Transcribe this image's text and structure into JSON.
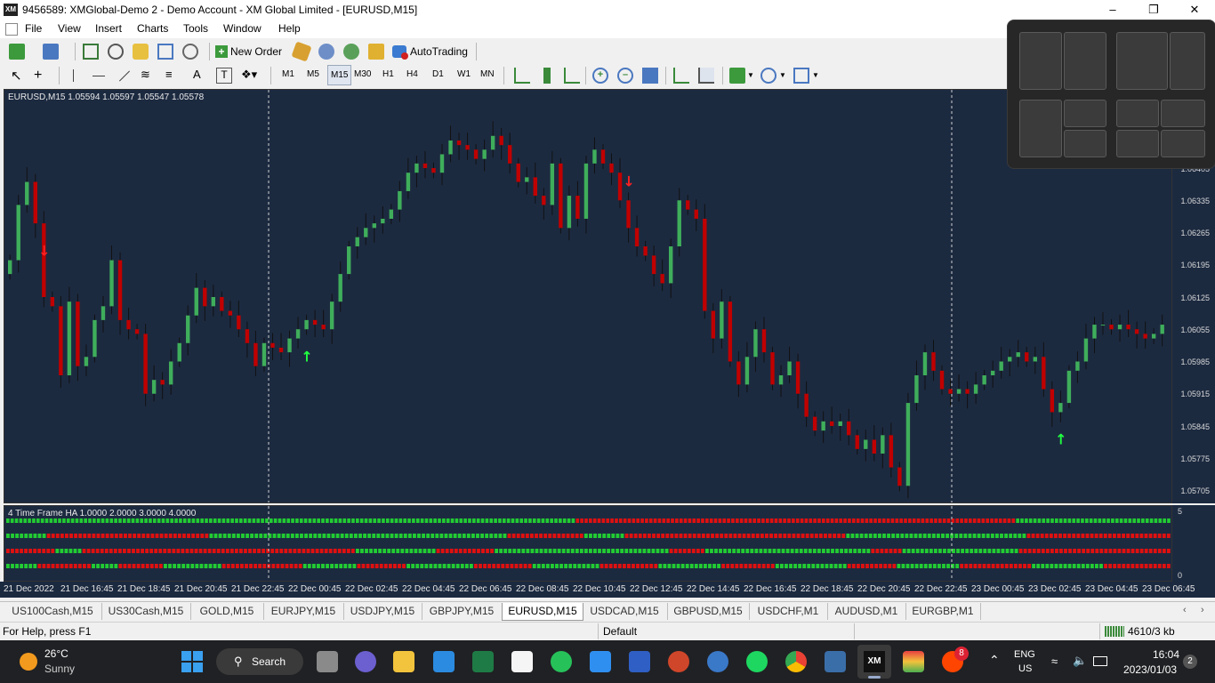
{
  "window": {
    "logo": "XM",
    "title": "9456589: XMGlobal-Demo 2 - Demo Account - XM Global Limited - [EURUSD,M15]",
    "min_icon": "minimize-icon",
    "max_icon": "restore-icon",
    "close_icon": "close-icon"
  },
  "menu": [
    "File",
    "View",
    "Insert",
    "Charts",
    "Tools",
    "Window",
    "Help"
  ],
  "toolbar": {
    "new_order": "New Order",
    "autotrading": "AutoTrading",
    "timeframes": [
      "M1",
      "M5",
      "M15",
      "M30",
      "H1",
      "H4",
      "D1",
      "W1",
      "MN"
    ],
    "active_timeframe": "M15"
  },
  "chart": {
    "header": "EURUSD,M15  1.05594 1.05597 1.05547 1.05578",
    "bg": "#1c2a40",
    "bull_color": "#3fae5b",
    "bear_color": "#c00000"
  },
  "price_axis": [
    "1.06405",
    "1.06335",
    "1.06265",
    "1.06195",
    "1.06125",
    "1.06055",
    "1.05985",
    "1.05915",
    "1.05845",
    "1.05775",
    "1.05705"
  ],
  "indicator": {
    "header": "4 Time Frame HA 1.0000 2.0000 3.0000 4.0000",
    "axis_top": "5",
    "axis_bottom": "0",
    "rows": [
      "GGGGGGGGGGGGGGGGGGGGGGGGGGGGGGGGGGGGGGGGGGGGGGGGGGGGGGGGGGGGGGGGGGGGGGGGGGGGGGGGGGGGGGGGGGGGGGGGGGGGGGGGGGGGGGGGGGGGGGGGGGGGGGGGGGGGRRRRRRRRRRRRRRRRRRRRRRRRRRRRRRRRRRRRRRRRRRRRRRRRRRRRRRRRRRRRRRRRRRRRRRRRRRRRRRRRRRRRRRRRRRRRRRRRRRRRRRGGGGGGGGGGGGGGGGGGGGGGGGGGGGGGGGGGGG",
      "GGGGGGGGGRRRRRRRRRRRRRRRRRRRRRRRRRRRRRRRRRRRRGGGGGGGGGGGGGGGGGGGGGGGGGGGGGGGGGGGGGGGGGGGGGGGGGGGGGGGGGGGGGGGGGGRRRRRRRRRRRRRRRRRGGGGGGGGGRRRRRRRRRRRRRRRRRRRRRRRRRRRRRRRRRRRRRRRRRRRRRRRRRGGGGGGGGGGGGGGGGGGGGGGGGGGGGGGGGGGGGGGGGRRRRRRRRRRRRRRRRRRRRRRRRRRRRRRRR",
      "RRRRRRRRRRRGGGGGGRRRRRRRRRRRRRRRRRRRRRRRRRRRRRRRRRRRRRRRRRRRRRRRRRRRRRRRRRRRRRGGGGGGGGGGGGGGGGGGRRRRRRRRRRRRRGGGGGGGGGGGGGGGGGGGGGGGGGGGGGGGGGGGGGGGRRRRRRRRGGGGGGGGGGGGGGGGGGGGGGGGGGGGGGGGGGGGGRRRRRRRGGGGGGGGGGGGGGGGGGGGGGGGGGRRRRRRRRRRRRRRRRRRRRRRRRRRRRRRRRRR",
      "GGGGGGGRRRRRRRRRRRRGGGGGGRRRRRRRRRRGGGGGGGGGGGGGRRRRRRRRRRRRRRRRRRGGGGGGGGGGGGRRRRRRRRRRRGGGGGGGGGGGGGGGRRRRRRRRRRRRRGGGGGGGGGGGGGGGRRRRRRRRRRRRRGGGGGGGGGGGGGGRRRRRRRRRRRRGGGGGGGGGGGGGGGGRRRRRRRRRRRGGGGGGGGGGGGGGRRRRRRRRRRRRRRRRGGGGGGGGGGGGGGGGRRRRRRRRRRRRRRR"
    ]
  },
  "time_axis": [
    "21 Dec 2022",
    "21 Dec 16:45",
    "21 Dec 18:45",
    "21 Dec 20:45",
    "21 Dec 22:45",
    "22 Dec 00:45",
    "22 Dec 02:45",
    "22 Dec 04:45",
    "22 Dec 06:45",
    "22 Dec 08:45",
    "22 Dec 10:45",
    "22 Dec 12:45",
    "22 Dec 14:45",
    "22 Dec 16:45",
    "22 Dec 18:45",
    "22 Dec 20:45",
    "22 Dec 22:45",
    "23 Dec 00:45",
    "23 Dec 02:45",
    "23 Dec 04:45",
    "23 Dec 06:45"
  ],
  "symbol_tabs": [
    "US100Cash,M15",
    "US30Cash,M15",
    "GOLD,M15",
    "EURJPY,M15",
    "USDJPY,M15",
    "GBPJPY,M15",
    "EURUSD,M15",
    "USDCAD,M15",
    "GBPUSD,M15",
    "USDCHF,M1",
    "AUDUSD,M1",
    "EURGBP,M1"
  ],
  "active_symbol": "EURUSD,M15",
  "status": {
    "help": "For Help, press F1",
    "profile": "Default",
    "traffic": "4610/3 kb"
  },
  "taskbar": {
    "weather_temp": "26°C",
    "weather_text": "Sunny",
    "search": "Search",
    "lang1": "ENG",
    "lang2": "US",
    "time": "16:04",
    "date": "2023/01/03",
    "notif": "2",
    "badge": "8",
    "icons": [
      "taskview-icon",
      "chat-icon",
      "explorer-icon",
      "mail-icon",
      "excel-icon",
      "amazon-icon",
      "whatsapp-icon",
      "store-icon",
      "word-icon",
      "powerpoint-icon",
      "edge-like-icon",
      "spotify-icon",
      "chrome-icon",
      "stocks-icon",
      "xm-icon",
      "stack-icon",
      "reddit-icon"
    ]
  },
  "chart_data": {
    "type": "candlestick",
    "symbol": "EURUSD,M15",
    "ohlc_header": {
      "open": 1.05594,
      "high": 1.05597,
      "low": 1.05547,
      "close": 1.05578
    },
    "ylim": [
      1.0568,
      1.0658
    ],
    "closes": [
      1.0621,
      1.0633,
      1.0638,
      1.0629,
      1.0613,
      1.0611,
      1.0596,
      1.0612,
      1.0598,
      1.06,
      1.0608,
      1.0611,
      1.0621,
      1.0608,
      1.0606,
      1.0605,
      1.0592,
      1.0595,
      1.0594,
      1.0599,
      1.0603,
      1.0609,
      1.0615,
      1.0611,
      1.0613,
      1.061,
      1.0609,
      1.0606,
      1.0603,
      1.0598,
      1.0603,
      1.0602,
      1.0601,
      1.0604,
      1.0606,
      1.0608,
      1.0607,
      1.0606,
      1.0612,
      1.0618,
      1.0624,
      1.0626,
      1.0628,
      1.0629,
      1.063,
      1.0632,
      1.0636,
      1.064,
      1.0642,
      1.0641,
      1.064,
      1.0644,
      1.0647,
      1.0646,
      1.0645,
      1.0643,
      1.0645,
      1.0648,
      1.0646,
      1.0642,
      1.0638,
      1.0639,
      1.0635,
      1.0633,
      1.0642,
      1.0628,
      1.0635,
      1.063,
      1.0642,
      1.0645,
      1.0642,
      1.064,
      1.0634,
      1.0628,
      1.0624,
      1.0622,
      1.0618,
      1.0616,
      1.0624,
      1.0634,
      1.0632,
      1.063,
      1.061,
      1.0604,
      1.0612,
      1.0599,
      1.0594,
      1.06,
      1.0606,
      1.0601,
      1.0594,
      1.0596,
      1.0599,
      1.0592,
      1.0587,
      1.0584,
      1.0586,
      1.0585,
      1.0586,
      1.0583,
      1.058,
      1.0582,
      1.0579,
      1.0583,
      1.0576,
      1.0572,
      1.059,
      1.0596,
      1.0601,
      1.0597,
      1.0593,
      1.0592,
      1.0593,
      1.0592,
      1.0594,
      1.0596,
      1.0597,
      1.0599,
      1.06,
      1.0601,
      1.0599,
      1.06,
      1.0593,
      1.0588,
      1.059,
      1.0597,
      1.0599,
      1.0604,
      1.0607,
      1.0607,
      1.0606,
      1.0607,
      1.0606,
      1.0605,
      1.0604,
      1.0605,
      1.0607
    ]
  }
}
